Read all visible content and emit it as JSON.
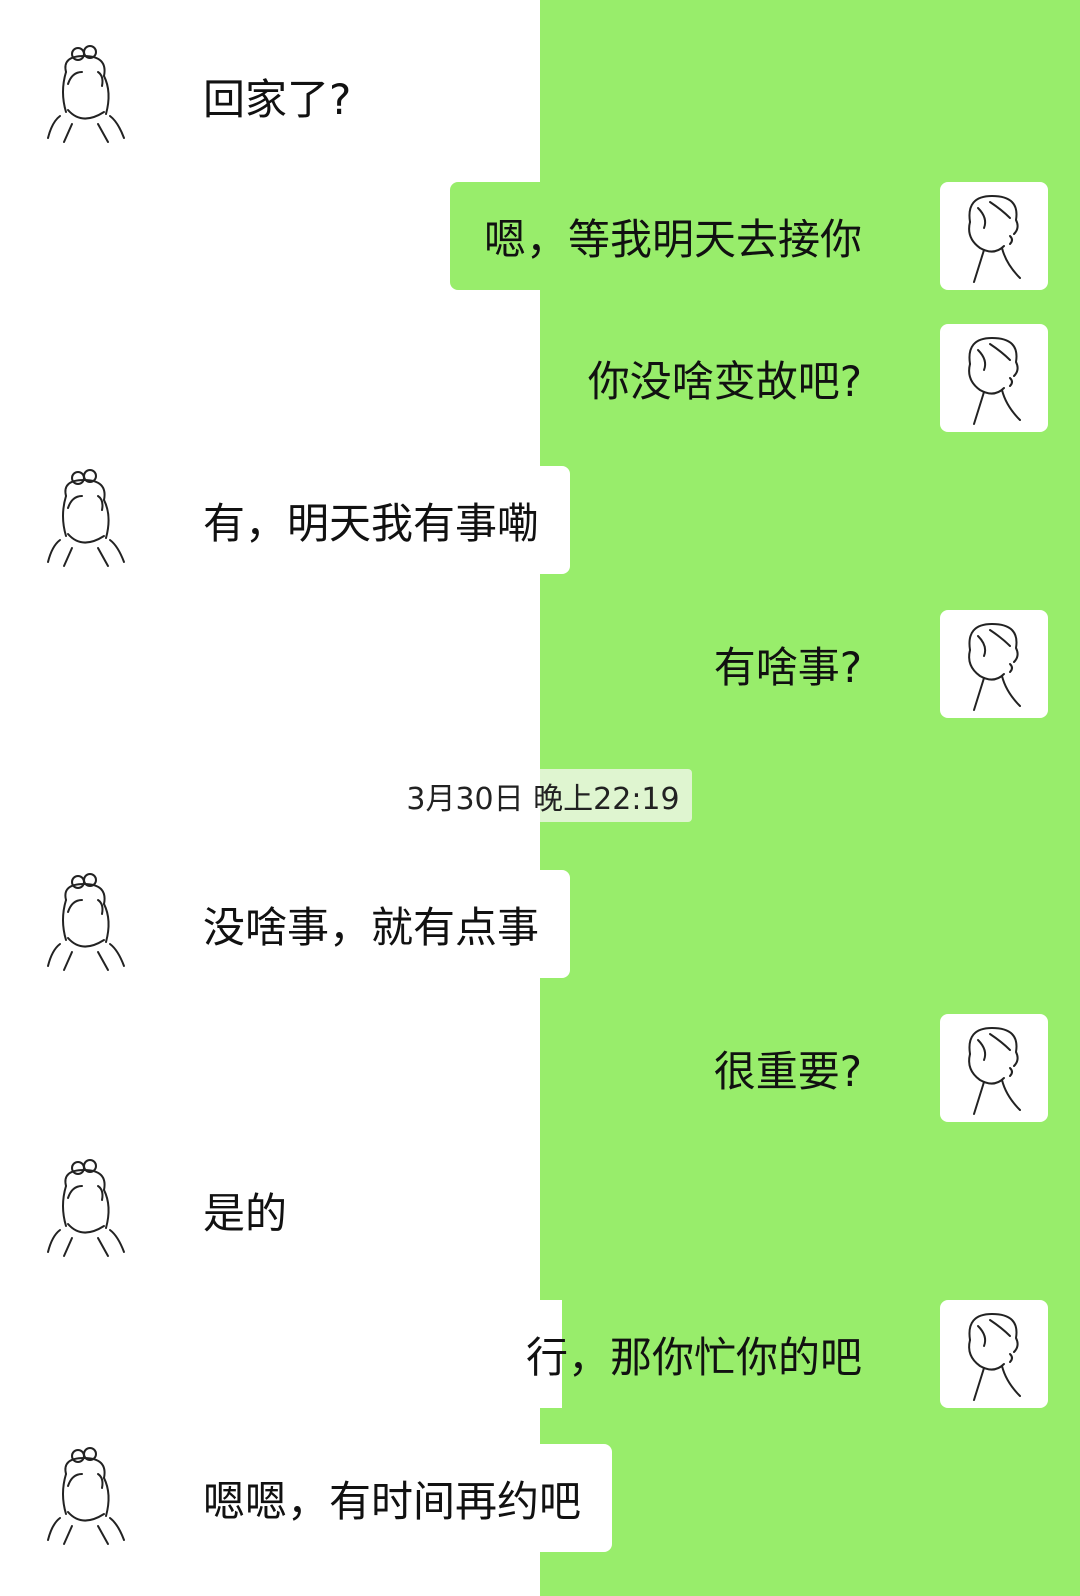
{
  "chat": {
    "timestamp": "3月30日 晚上22:19",
    "messages": [
      {
        "side": "left",
        "text": "回家了?"
      },
      {
        "side": "right",
        "text": "嗯，等我明天去接你"
      },
      {
        "side": "right",
        "text": "你没啥变故吧?"
      },
      {
        "side": "left",
        "text": "有，明天我有事嘞"
      },
      {
        "side": "right",
        "text": "有啥事?"
      },
      {
        "side": "left",
        "text": "没啥事，就有点事"
      },
      {
        "side": "right",
        "text": "很重要?"
      },
      {
        "side": "left",
        "text": "是的"
      },
      {
        "side": "right",
        "text": "行，那你忙你的吧"
      },
      {
        "side": "left",
        "text": "嗯嗯，有时间再约吧"
      }
    ]
  },
  "colors": {
    "background_left": "#ffffff",
    "background_right": "#98ed6b",
    "bubble_text": "#111111"
  },
  "icons": {
    "contact_avatar": "girl-line-drawing-icon",
    "self_avatar": "boy-line-drawing-icon"
  }
}
